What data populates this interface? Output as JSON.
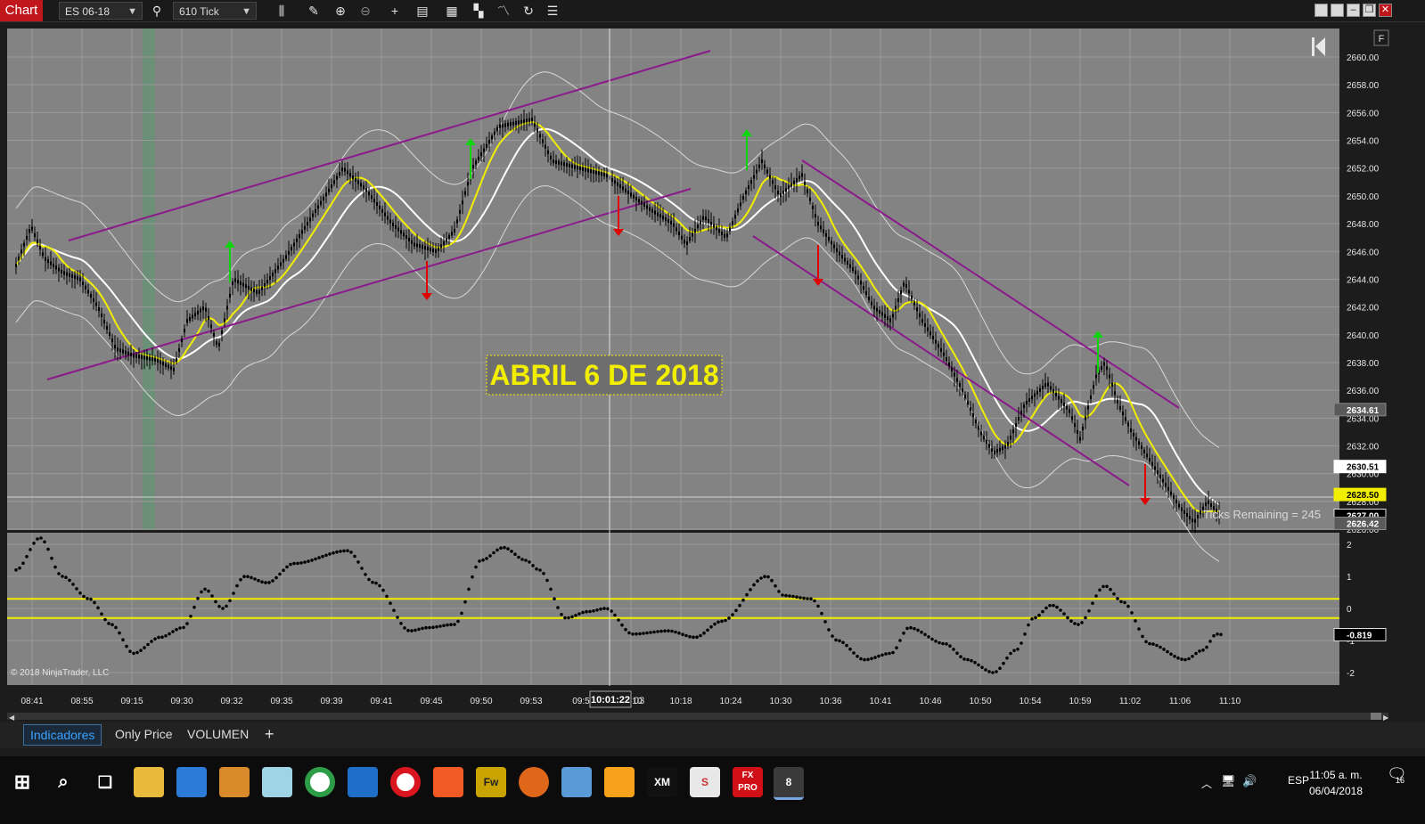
{
  "toolbar": {
    "chart_tab": "Chart",
    "instrument": "ES 06-18",
    "interval": "610 Tick",
    "icons": [
      "search-icon",
      "bar-type-icon",
      "draw-pencil-icon",
      "zoom-in-icon",
      "zoom-out-icon",
      "crosshair-icon",
      "properties-icon",
      "data-box-icon",
      "strategies-icon",
      "indicators-icon",
      "refresh-icon",
      "list-icon"
    ],
    "window_controls": [
      "tile-icon",
      "tile-icon",
      "minimize-icon",
      "restore-icon",
      "close-icon"
    ]
  },
  "chart": {
    "overlay_title": "ABRIL 6 DE 2018",
    "copyright": "© 2018 NinjaTrader, LLC",
    "ticks_remaining": "Ticks Remaining = 245",
    "f_button": "F",
    "crosshair_time": "10:01:22",
    "crosshair_time_tail": "03",
    "price_axis_labels": [
      "2660.00",
      "2658.00",
      "2656.00",
      "2654.00",
      "2652.00",
      "2650.00",
      "2648.00",
      "2646.00",
      "2644.00",
      "2642.00",
      "2640.00",
      "2638.00",
      "2636.00",
      "2634.00",
      "2632.00",
      "2630.00",
      "2628.00",
      "2626.00"
    ],
    "price_markers": [
      {
        "label": "2634.61",
        "value": 2634.61,
        "style": "gray"
      },
      {
        "label": "2630.51",
        "value": 2630.51,
        "style": "white"
      },
      {
        "label": "2628.50",
        "value": 2628.5,
        "style": "yellow"
      },
      {
        "label": "2627.00",
        "value": 2627.0,
        "style": "black"
      },
      {
        "label": "2626.42",
        "value": 2626.42,
        "style": "gray"
      }
    ],
    "osc_axis_labels": [
      "2",
      "1",
      "0",
      "-1",
      "-2"
    ],
    "osc_marker": "-0.819",
    "osc_marker_value": -0.819,
    "time_axis_labels": [
      "08:41",
      "08:55",
      "09:15",
      "09:30",
      "09:32",
      "09:35",
      "09:39",
      "09:41",
      "09:45",
      "09:50",
      "09:53",
      "09:5",
      "10:10",
      "10:18",
      "10:24",
      "10:30",
      "10:36",
      "10:41",
      "10:46",
      "10:50",
      "10:54",
      "10:59",
      "11:02",
      "11:06",
      "11:10"
    ]
  },
  "tabs": {
    "t1": "Indicadores",
    "t2": "Only Price",
    "t3": "VOLUMEN",
    "add": "+"
  },
  "taskbar": {
    "lang": "ESP",
    "time": "11:05 a. m.",
    "date": "06/04/2018",
    "notif_count": "16",
    "apps": [
      "windows-start-icon",
      "search-icon",
      "task-view-icon",
      "file-explorer-icon",
      "store-icon",
      "media-player-icon",
      "notes-icon",
      "chrome-icon",
      "app-icon",
      "opera-icon",
      "brave-icon",
      "fireworks-icon",
      "firefox-icon",
      "paint-icon",
      "app-icon",
      "xm-icon",
      "slack-icon",
      "fxpro-icon",
      "ninjatrader-icon"
    ],
    "xm_label": "XM",
    "fw_label": "Fw",
    "fxpro_label": "FX PRO",
    "nt_label": "8"
  },
  "colors": {
    "bg": "#838383",
    "grid": "#9a9a9a",
    "yellow": "#f2ee00",
    "magenta": "#8b1a8b",
    "green": "#0dd30d",
    "red": "#e10000",
    "accent": "#c0171d"
  }
}
